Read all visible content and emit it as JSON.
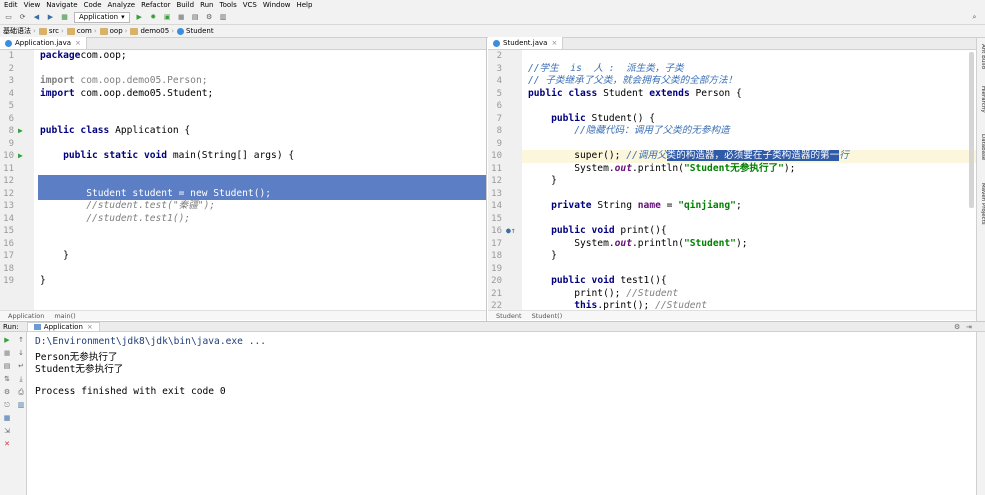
{
  "menu": [
    "Edit",
    "View",
    "Navigate",
    "Code",
    "Analyze",
    "Refactor",
    "Build",
    "Run",
    "Tools",
    "VCS",
    "Window",
    "Help"
  ],
  "toolbar": {
    "run_config": "Application"
  },
  "navbar": {
    "project": "基础语法",
    "crumbs": [
      "src",
      "com",
      "oop",
      "demo05",
      "Student"
    ]
  },
  "left_editor": {
    "tab": "Application.java",
    "lines": [
      {
        "n": "1",
        "parts": [
          [
            "kw",
            "package"
          ],
          [
            "",
            "com.oop;"
          ]
        ]
      },
      {
        "n": "2",
        "parts": []
      },
      {
        "n": "3",
        "parts": [
          [
            "kw gray",
            "import"
          ],
          [
            "gray",
            " com.oop.demo05.Person;"
          ]
        ]
      },
      {
        "n": "4",
        "parts": [
          [
            "kw",
            "import"
          ],
          [
            "",
            " com.oop.demo05.Student;"
          ]
        ]
      },
      {
        "n": "5",
        "parts": []
      },
      {
        "n": "6",
        "parts": []
      },
      {
        "n": "8",
        "parts": [
          [
            "kw",
            "public class"
          ],
          [
            "",
            " Application {"
          ]
        ]
      },
      {
        "n": "9",
        "parts": []
      },
      {
        "n": "10",
        "parts": [
          [
            "",
            "    "
          ],
          [
            "kw",
            "public static void"
          ],
          [
            "",
            " main(String[] args) {"
          ]
        ]
      },
      {
        "n": "11",
        "parts": []
      },
      {
        "n": "12",
        "parts": []
      },
      {
        "n": "13",
        "parts": [
          [
            "cm",
            "        //student.test(\"秦疆\");"
          ]
        ]
      },
      {
        "n": "14",
        "parts": [
          [
            "cm",
            "        //student.test1();"
          ]
        ]
      },
      {
        "n": "15",
        "parts": []
      },
      {
        "n": "16",
        "parts": []
      },
      {
        "n": "17",
        "parts": [
          [
            "",
            "    }"
          ]
        ]
      },
      {
        "n": "18",
        "parts": []
      },
      {
        "n": "19",
        "parts": [
          [
            "",
            "}"
          ]
        ]
      }
    ],
    "selected_line": "        Student student = new Student();",
    "selected_n": "12",
    "breadcrumb": [
      "Application",
      "main()"
    ]
  },
  "right_editor": {
    "tab": "Student.java",
    "lines": [
      {
        "n": "2",
        "parts": []
      },
      {
        "n": "3",
        "parts": [
          [
            "cmcn",
            "//学生  is  人 :  派生类，子类"
          ]
        ]
      },
      {
        "n": "4",
        "parts": [
          [
            "cmcn",
            "// 子类继承了父类，就会拥有父类的全部方法！"
          ]
        ]
      },
      {
        "n": "5",
        "parts": [
          [
            "kw",
            "public class"
          ],
          [
            "",
            " Student "
          ],
          [
            "kw",
            "extends"
          ],
          [
            "",
            " Person {"
          ]
        ]
      },
      {
        "n": "6",
        "parts": []
      },
      {
        "n": "7",
        "parts": [
          [
            "",
            "    "
          ],
          [
            "kw",
            "public"
          ],
          [
            "",
            " Student() {"
          ]
        ]
      },
      {
        "n": "8",
        "parts": [
          [
            "cmcn",
            "        //隐藏代码：调用了父类的无参构造"
          ]
        ]
      },
      {
        "n": "9",
        "parts": []
      },
      {
        "n": "10",
        "parts": []
      },
      {
        "n": "11",
        "parts": [
          [
            "",
            "        System."
          ],
          [
            "fld it",
            "out"
          ],
          [
            "",
            ".println("
          ],
          [
            "str",
            "\"Student无参执行了\""
          ],
          [
            "",
            ");"
          ]
        ]
      },
      {
        "n": "12",
        "parts": [
          [
            "",
            "    }"
          ]
        ]
      },
      {
        "n": "13",
        "parts": []
      },
      {
        "n": "14",
        "parts": [
          [
            "",
            "    "
          ],
          [
            "kw",
            "private"
          ],
          [
            "",
            " String "
          ],
          [
            "fld",
            "name"
          ],
          [
            "",
            " = "
          ],
          [
            "str",
            "\"qinjiang\""
          ],
          [
            "",
            ";"
          ]
        ]
      },
      {
        "n": "15",
        "parts": []
      },
      {
        "n": "16",
        "parts": [
          [
            "",
            "    "
          ],
          [
            "kw",
            "public void"
          ],
          [
            "",
            " print(){"
          ]
        ]
      },
      {
        "n": "17",
        "parts": [
          [
            "",
            "        System."
          ],
          [
            "fld it",
            "out"
          ],
          [
            "",
            ".println("
          ],
          [
            "str",
            "\"Student\""
          ],
          [
            "",
            ");"
          ]
        ]
      },
      {
        "n": "18",
        "parts": [
          [
            "",
            "    }"
          ]
        ]
      },
      {
        "n": "19",
        "parts": []
      },
      {
        "n": "20",
        "parts": [
          [
            "",
            "    "
          ],
          [
            "kw",
            "public void"
          ],
          [
            "",
            " test1(){"
          ]
        ]
      },
      {
        "n": "21",
        "parts": [
          [
            "",
            "        print(); "
          ],
          [
            "cm",
            "//Student"
          ]
        ]
      },
      {
        "n": "22",
        "parts": [
          [
            "",
            "        "
          ],
          [
            "kw",
            "this"
          ],
          [
            "",
            ".print(); "
          ],
          [
            "cm",
            "//Student"
          ]
        ]
      }
    ],
    "line10_pre": "        super(); ",
    "line10_cm1": "//调用父",
    "line10_sel": "类的构造器，必须要在子类构造器的第一",
    "line10_cm2": "行",
    "breadcrumb": [
      "Student",
      "Student()"
    ]
  },
  "run_panel": {
    "label": "Run:",
    "tab": "Application",
    "output": [
      "D:\\Environment\\jdk8\\jdk\\bin\\java.exe ...",
      "Person无参执行了",
      "Student无参执行了",
      "",
      "Process finished with exit code 0"
    ]
  },
  "right_tools": [
    "Ant Build",
    "Hierarchy",
    "Database",
    "Maven Projects"
  ]
}
